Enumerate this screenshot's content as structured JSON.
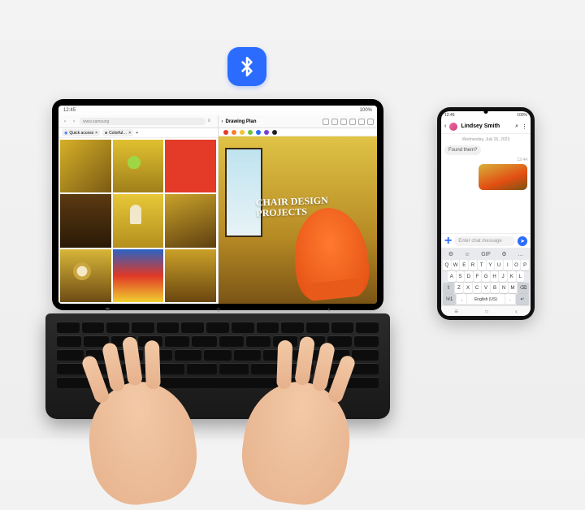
{
  "bluetooth_icon": "bluetooth",
  "tablet": {
    "status": {
      "time": "12:45",
      "battery": "100%"
    },
    "browser": {
      "back": "‹",
      "forward": "›",
      "address": "www.samsung",
      "tabs": [
        {
          "label": "Quick access"
        },
        {
          "label": "Colorful…"
        }
      ]
    },
    "drawing": {
      "back": "‹",
      "title": "Drawing Plan",
      "swatches": [
        "#e33b27",
        "#ff7a2f",
        "#f0c330",
        "#6fbf3a",
        "#2b6cff",
        "#7a3fd6",
        "#222222"
      ],
      "annotation": "CHAIR DESIGN\nPROJECTS"
    },
    "nav": {
      "recent": "≡",
      "home": "○",
      "back": "‹"
    }
  },
  "phone": {
    "status": {
      "time": "12:45",
      "battery": "100%"
    },
    "chat": {
      "back": "‹",
      "contact": "Lindsey Smith",
      "menu_search": "⌕",
      "menu_more": "⋮",
      "date": "Wednesday, July 26, 2023",
      "message": "Found them?",
      "time_stamp": "12:44",
      "input_placeholder": "Enter chat message",
      "plus": "+",
      "send": "➤"
    },
    "keyboard": {
      "suggestions": [
        "⚙",
        "☺",
        "GIF",
        "⚙",
        "…"
      ],
      "rows": [
        [
          "Q",
          "W",
          "E",
          "R",
          "T",
          "Y",
          "U",
          "I",
          "O",
          "P"
        ],
        [
          "A",
          "S",
          "D",
          "F",
          "G",
          "H",
          "J",
          "K",
          "L"
        ],
        [
          "⇧",
          "Z",
          "X",
          "C",
          "V",
          "B",
          "N",
          "M",
          "⌫"
        ],
        [
          "!#1",
          ",",
          "English (US)",
          ".",
          "↵"
        ]
      ]
    },
    "nav": {
      "recent": "≡",
      "home": "○",
      "back": "‹"
    }
  }
}
